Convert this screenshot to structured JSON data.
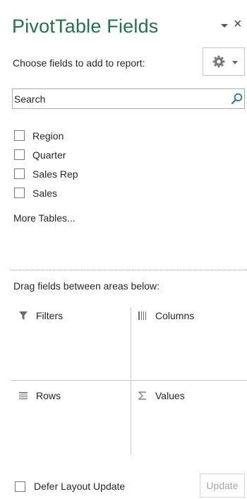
{
  "header": {
    "title": "PivotTable Fields",
    "close_glyph": "×"
  },
  "chooser": {
    "label": "Choose fields to add to report:"
  },
  "search": {
    "placeholder": "Search",
    "value": ""
  },
  "fields": [
    {
      "label": "Region",
      "checked": false
    },
    {
      "label": "Quarter",
      "checked": false
    },
    {
      "label": "Sales Rep",
      "checked": false
    },
    {
      "label": "Sales",
      "checked": false
    }
  ],
  "more_tables": "More Tables...",
  "drag_instructions": "Drag fields between areas below:",
  "areas": {
    "filters": "Filters",
    "columns": "Columns",
    "rows": "Rows",
    "values": "Values"
  },
  "footer": {
    "defer_label": "Defer Layout Update",
    "defer_checked": false,
    "update_label": "Update"
  },
  "colors": {
    "accent": "#217346",
    "text": "#262626",
    "border": "#c6c6c6",
    "disabled_text": "#a6a6a6"
  },
  "icons": [
    "chevron-down-icon",
    "close-icon",
    "gear-icon",
    "search-icon",
    "filter-icon",
    "columns-icon",
    "rows-icon",
    "sigma-icon"
  ]
}
